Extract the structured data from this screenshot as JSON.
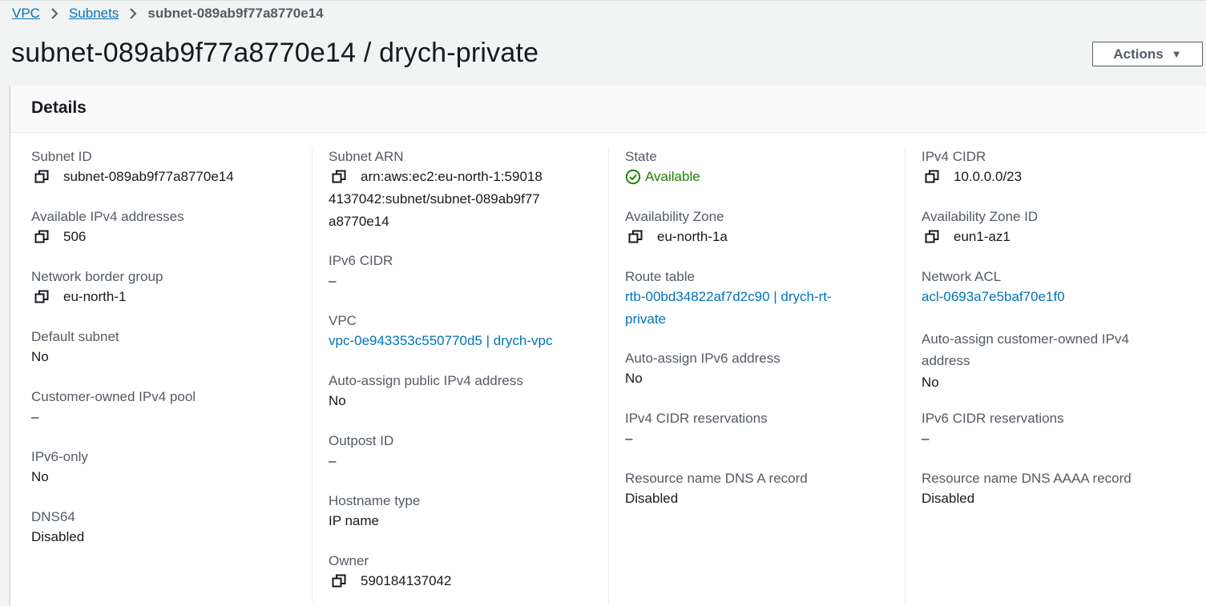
{
  "breadcrumb": {
    "items": [
      "VPC",
      "Subnets"
    ],
    "current": "subnet-089ab9f77a8770e14"
  },
  "page": {
    "title": "subnet-089ab9f77a8770e14 / drych-private",
    "actions_label": "Actions"
  },
  "details": {
    "title": "Details",
    "col1": {
      "subnet_id": {
        "label": "Subnet ID",
        "value": "subnet-089ab9f77a8770e14"
      },
      "available_ipv4": {
        "label": "Available IPv4 addresses",
        "value": "506"
      },
      "network_border_group": {
        "label": "Network border group",
        "value": "eu-north-1"
      },
      "default_subnet": {
        "label": "Default subnet",
        "value": "No"
      },
      "customer_owned_pool": {
        "label": "Customer-owned IPv4 pool",
        "value": "–"
      },
      "ipv6_only": {
        "label": "IPv6-only",
        "value": "No"
      },
      "dns64": {
        "label": "DNS64",
        "value": "Disabled"
      }
    },
    "col2": {
      "subnet_arn": {
        "label": "Subnet ARN",
        "value": "arn:aws:ec2:eu-north-1:590184137042:subnet/subnet-089ab9f77a8770e14"
      },
      "ipv6_cidr": {
        "label": "IPv6 CIDR",
        "value": "–"
      },
      "vpc": {
        "label": "VPC",
        "value": "vpc-0e943353c550770d5 | drych-vpc"
      },
      "auto_public_ipv4": {
        "label": "Auto-assign public IPv4 address",
        "value": "No"
      },
      "outpost_id": {
        "label": "Outpost ID",
        "value": "–"
      },
      "hostname_type": {
        "label": "Hostname type",
        "value": "IP name"
      },
      "owner": {
        "label": "Owner",
        "value": "590184137042"
      }
    },
    "col3": {
      "state": {
        "label": "State",
        "value": "Available"
      },
      "az": {
        "label": "Availability Zone",
        "value": "eu-north-1a"
      },
      "route_table": {
        "label": "Route table",
        "value": "rtb-00bd34822af7d2c90 | drych-rt-private"
      },
      "auto_ipv6": {
        "label": "Auto-assign IPv6 address",
        "value": "No"
      },
      "ipv4_cidr_res": {
        "label": "IPv4 CIDR reservations",
        "value": "–"
      },
      "dns_a": {
        "label": "Resource name DNS A record",
        "value": "Disabled"
      }
    },
    "col4": {
      "ipv4_cidr": {
        "label": "IPv4 CIDR",
        "value": "10.0.0.0/23"
      },
      "az_id": {
        "label": "Availability Zone ID",
        "value": "eun1-az1"
      },
      "network_acl": {
        "label": "Network ACL",
        "value": "acl-0693a7e5baf70e1f0"
      },
      "auto_customer_owned": {
        "label": "Auto-assign customer-owned IPv4 address",
        "value": "No"
      },
      "ipv6_cidr_res": {
        "label": "IPv6 CIDR reservations",
        "value": "–"
      },
      "dns_aaaa": {
        "label": "Resource name DNS AAAA record",
        "value": "Disabled"
      }
    }
  },
  "colors": {
    "link": "#0073bb",
    "success": "#1d8102",
    "text": "#16191f",
    "label": "#545b64"
  },
  "icons": {
    "copy": "copy-icon",
    "status": "status-positive-icon",
    "separator": "chevron-right-icon",
    "dropdown": "caret-down-icon"
  }
}
